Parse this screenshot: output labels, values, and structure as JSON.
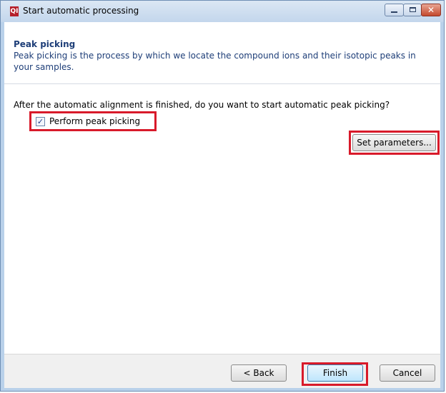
{
  "window": {
    "title": "Start automatic processing",
    "app_icon_text": "QI"
  },
  "header": {
    "title": "Peak picking",
    "description": "Peak picking is the process by which we locate the compound ions and their isotopic peaks in your samples."
  },
  "content": {
    "question": "After the automatic alignment is finished, do you want to start automatic peak picking?",
    "checkbox": {
      "label": "Perform peak picking",
      "checked": true
    },
    "set_parameters_label": "Set parameters..."
  },
  "footer": {
    "back_label": "< Back",
    "finish_label": "Finish",
    "cancel_label": "Cancel"
  },
  "colors": {
    "highlight": "#d81a2a",
    "header_text": "#1e3e78",
    "titlebar": "#c3d6ec"
  }
}
